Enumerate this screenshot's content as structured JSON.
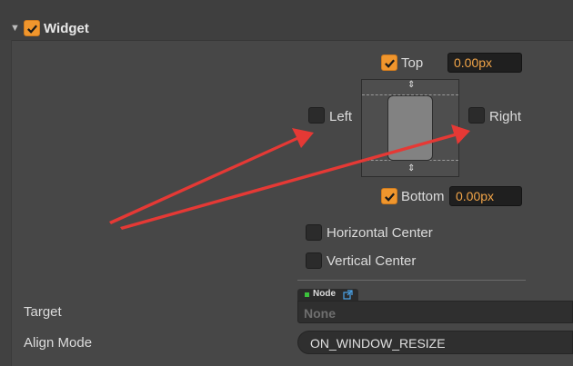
{
  "widget": {
    "title": "Widget",
    "enabled": true,
    "top": {
      "label": "Top",
      "checked": true,
      "value": "0.00px"
    },
    "bottom": {
      "label": "Bottom",
      "checked": true,
      "value": "0.00px"
    },
    "left": {
      "label": "Left",
      "checked": false
    },
    "right": {
      "label": "Right",
      "checked": false
    },
    "horizontal_center": {
      "label": "Horizontal Center",
      "checked": false
    },
    "vertical_center": {
      "label": "Vertical Center",
      "checked": false
    }
  },
  "target": {
    "label": "Target",
    "badge": "Node",
    "value": "None"
  },
  "align_mode": {
    "label": "Align Mode",
    "value": "ON_WINDOW_RESIZE"
  },
  "icons": [
    "expand-triangle-icon",
    "check-icon",
    "external-link-icon",
    "annotation-arrow-icon"
  ],
  "colors": {
    "accent": "#f0962d",
    "value_text": "#f2a548",
    "annotation": "#e53935",
    "badge_dot": "#3cc23c"
  }
}
